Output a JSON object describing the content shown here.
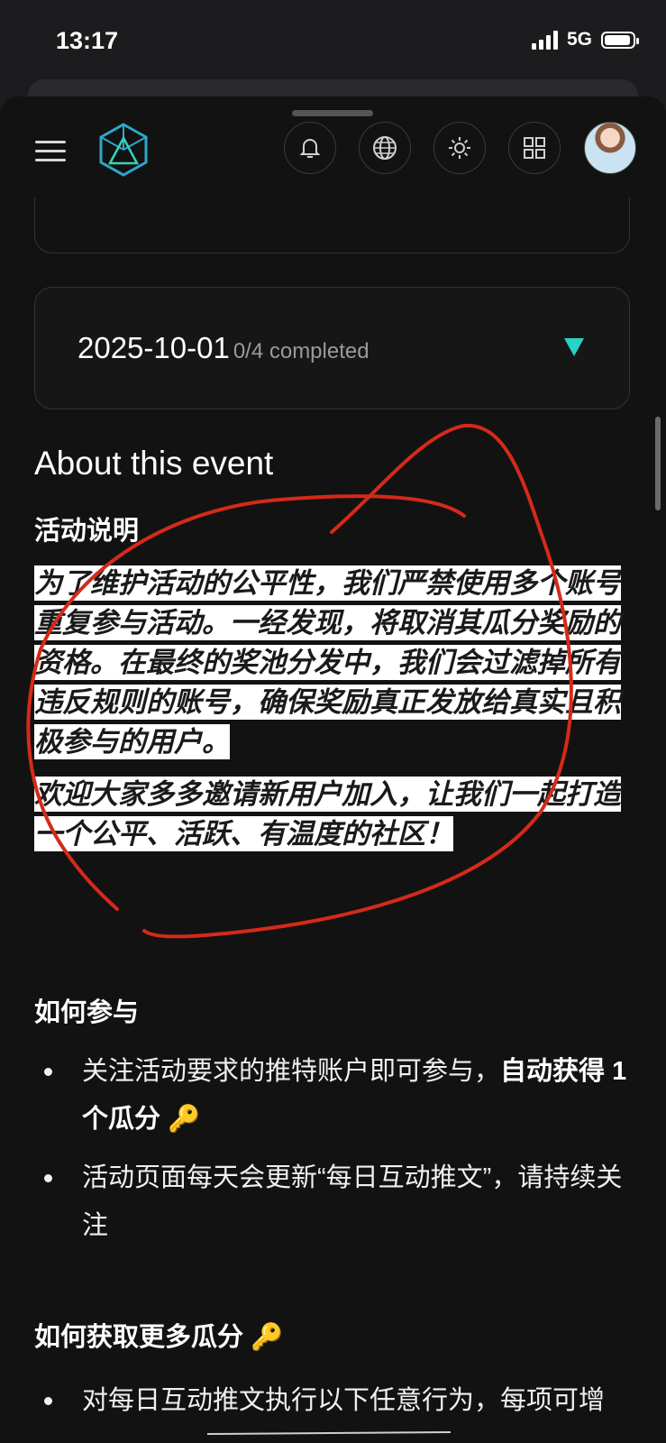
{
  "status": {
    "time": "13:17",
    "network": "5G"
  },
  "event": {
    "date": "2025-10-01",
    "progress": "0/4 completed"
  },
  "about": {
    "title": "About this event",
    "rules_heading": "活动说明",
    "rules_paragraph_1": "为了维护活动的公平性，我们严禁使用多个账号重复参与活动。一经发现，将取消其瓜分奖励的资格。在最终的奖池分发中，我们会过滤掉所有违反规则的账号，确保奖励真正发放给真实且积极参与的用户。",
    "rules_paragraph_2": "欢迎大家多多邀请新用户加入，让我们一起打造一个公平、活跃、有温度的社区！",
    "how_heading": "如何参与",
    "how_items": [
      {
        "text": "关注活动要求的推特账户即可参与，",
        "bold": "自动获得 1 个瓜分",
        "icon": "🔑"
      },
      {
        "text": "活动页面每天会更新“每日互动推文”，请持续关注"
      }
    ],
    "more_heading": "如何获取更多瓜分",
    "more_icon": "🔑",
    "more_items": [
      {
        "text": "对每日互动推文执行以下任意行为，每项可增"
      }
    ]
  },
  "colors": {
    "accent": "#27d3c3",
    "annotation": "#d42a1a",
    "highlight": "#ffffff"
  },
  "icons": [
    "menu-icon",
    "app-logo-icon",
    "bell-icon",
    "globe-icon",
    "sun-icon",
    "grid-icon",
    "key-icon"
  ]
}
